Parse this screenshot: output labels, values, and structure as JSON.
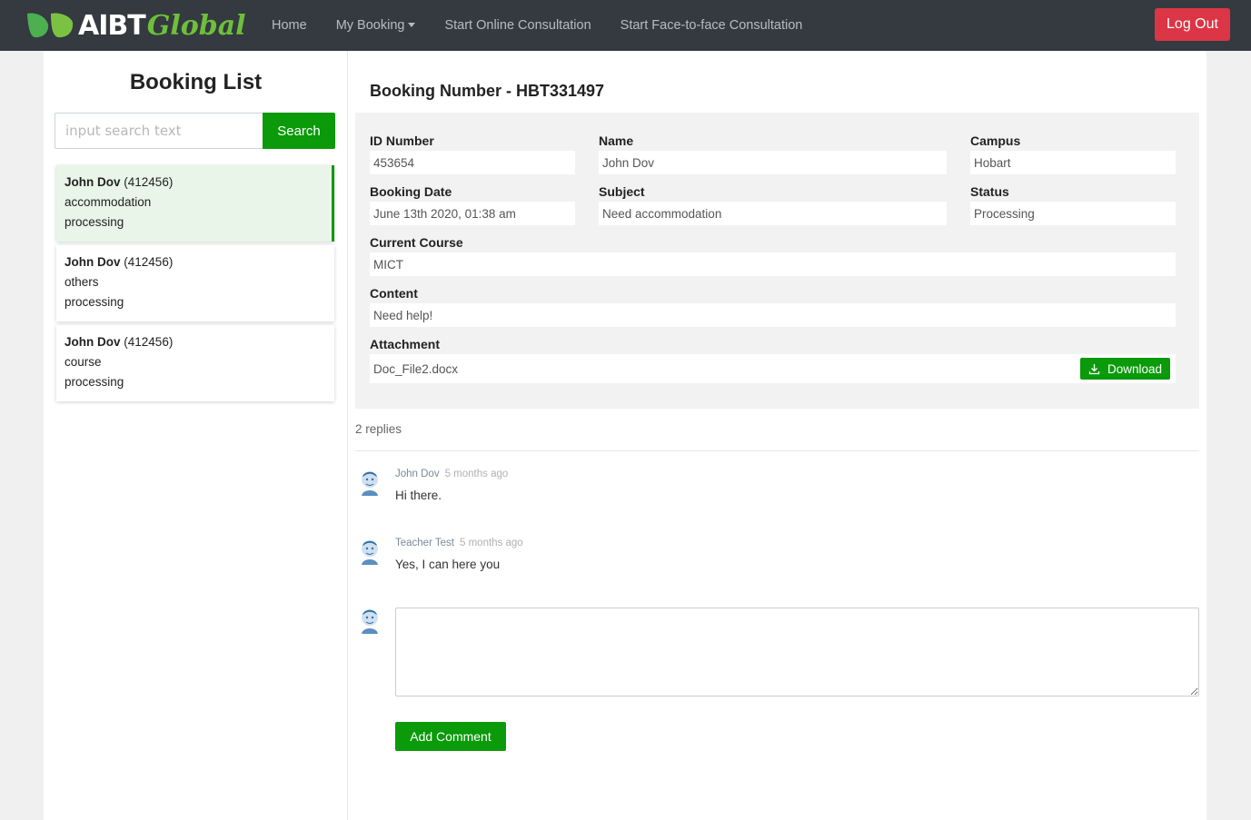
{
  "navbar": {
    "brand_main": "AIBT",
    "brand_accent": "Global",
    "links": [
      "Home",
      "My Booking",
      "Start Online Consultation",
      "Start Face-to-face Consultation"
    ],
    "logout_label": "Log Out"
  },
  "left": {
    "title": "Booking List",
    "search_placeholder": "input search text",
    "search_label": "Search",
    "bookings": [
      {
        "name": "John Dov",
        "id": "(412456)",
        "subject": "accommodation",
        "status": "processing",
        "active": true
      },
      {
        "name": "John Dov",
        "id": "(412456)",
        "subject": "others",
        "status": "processing",
        "active": false
      },
      {
        "name": "John Dov",
        "id": "(412456)",
        "subject": "course",
        "status": "processing",
        "active": false
      }
    ]
  },
  "detail": {
    "booking_number": "Booking Number - HBT331497",
    "labels": {
      "id_number": "ID Number",
      "name": "Name",
      "campus": "Campus",
      "booking_date": "Booking Date",
      "subject": "Subject",
      "status": "Status",
      "current_course": "Current Course",
      "content": "Content",
      "attachment": "Attachment"
    },
    "values": {
      "id_number": "453654",
      "name": "John Dov",
      "campus": "Hobart",
      "booking_date": "June 13th 2020, 01:38 am",
      "subject": "Need accommodation",
      "status": "Processing",
      "current_course": "MICT",
      "content": "Need help!",
      "attachment": "Doc_File2.docx"
    },
    "download_label": "Download"
  },
  "comments": {
    "count_label": "2 replies",
    "items": [
      {
        "author": "John Dov",
        "time": "5 months ago",
        "text": "Hi there."
      },
      {
        "author": "Teacher Test",
        "time": "5 months ago",
        "text": "Yes, I can here you"
      }
    ],
    "add_label": "Add Comment"
  },
  "colors": {
    "navbar": "#343a40",
    "primary_green": "#0a9a0a",
    "danger": "#dc3545",
    "active_card": "#e8f5e8"
  }
}
